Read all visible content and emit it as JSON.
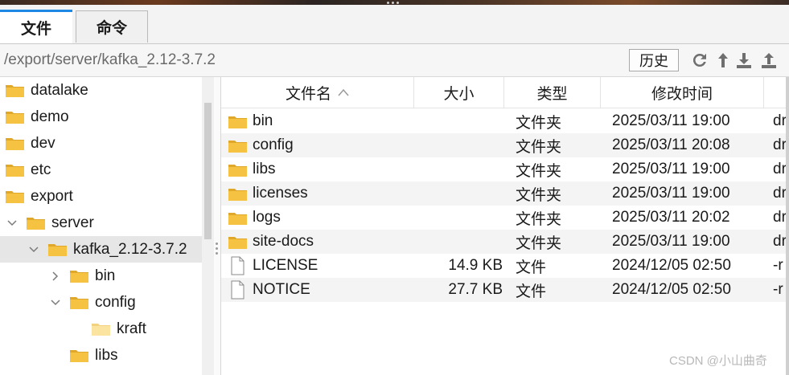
{
  "tabs": [
    {
      "label": "文件",
      "active": true
    },
    {
      "label": "命令",
      "active": false
    }
  ],
  "path": "/export/server/kafka_2.12-3.7.2",
  "toolbar": {
    "history_label": "历史",
    "icons": [
      "refresh-icon",
      "up-arrow-icon",
      "download-icon",
      "upload-icon"
    ]
  },
  "tree": [
    {
      "label": "datalake",
      "depth": 0,
      "expander": "none",
      "selected": false
    },
    {
      "label": "demo",
      "depth": 0,
      "expander": "none",
      "selected": false
    },
    {
      "label": "dev",
      "depth": 0,
      "expander": "none",
      "selected": false
    },
    {
      "label": "etc",
      "depth": 0,
      "expander": "none",
      "selected": false
    },
    {
      "label": "export",
      "depth": 0,
      "expander": "none",
      "selected": false
    },
    {
      "label": "server",
      "depth": 1,
      "expander": "expanded",
      "selected": false
    },
    {
      "label": "kafka_2.12-3.7.2",
      "depth": 2,
      "expander": "expanded",
      "selected": true
    },
    {
      "label": "bin",
      "depth": 3,
      "expander": "collapsed",
      "selected": false
    },
    {
      "label": "config",
      "depth": 3,
      "expander": "expanded",
      "selected": false
    },
    {
      "label": "kraft",
      "depth": 4,
      "expander": "none",
      "selected": false
    },
    {
      "label": "libs",
      "depth": 3,
      "expander": "none",
      "selected": false
    }
  ],
  "table": {
    "headers": {
      "name": "文件名",
      "size": "大小",
      "type": "类型",
      "modified": "修改时间"
    },
    "rows": [
      {
        "name": "bin",
        "size": "",
        "type": "文件夹",
        "modified": "2025/03/11 19:00",
        "perm": "dr",
        "kind": "folder"
      },
      {
        "name": "config",
        "size": "",
        "type": "文件夹",
        "modified": "2025/03/11 20:08",
        "perm": "dr",
        "kind": "folder"
      },
      {
        "name": "libs",
        "size": "",
        "type": "文件夹",
        "modified": "2025/03/11 19:00",
        "perm": "dr",
        "kind": "folder"
      },
      {
        "name": "licenses",
        "size": "",
        "type": "文件夹",
        "modified": "2025/03/11 19:00",
        "perm": "dr",
        "kind": "folder"
      },
      {
        "name": "logs",
        "size": "",
        "type": "文件夹",
        "modified": "2025/03/11 20:02",
        "perm": "dr",
        "kind": "folder"
      },
      {
        "name": "site-docs",
        "size": "",
        "type": "文件夹",
        "modified": "2025/03/11 19:00",
        "perm": "dr",
        "kind": "folder"
      },
      {
        "name": "LICENSE",
        "size": "14.9 KB",
        "type": "文件",
        "modified": "2024/12/05 02:50",
        "perm": "-r",
        "kind": "file"
      },
      {
        "name": "NOTICE",
        "size": "27.7 KB",
        "type": "文件",
        "modified": "2024/12/05 02:50",
        "perm": "-r",
        "kind": "file"
      }
    ]
  },
  "watermark": "CSDN @小山曲奇",
  "colors": {
    "folder": "#f5c242",
    "folder_dark": "#e0a82a",
    "tab_accent": "#1e88e5",
    "selected_row": "#e6e6e6",
    "alt_row": "#f4f4f4"
  }
}
